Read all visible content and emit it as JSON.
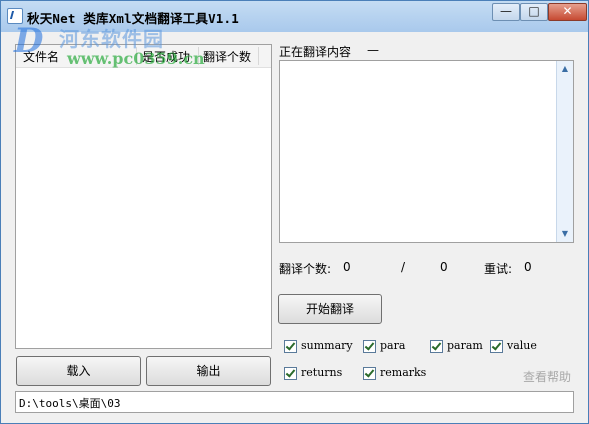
{
  "window": {
    "title": "秋天Net 类库Xml文档翻译工具V1.1",
    "minimize_glyph": "—",
    "maximize_glyph": "□",
    "close_glyph": "✕"
  },
  "watermark": {
    "logo_char": "D",
    "site_name": "河东软件园",
    "url": "www.pc0359.cn"
  },
  "file_list": {
    "columns": [
      "文件名",
      "是否成功",
      "翻译个数"
    ],
    "rows": []
  },
  "translating": {
    "label": "正在翻译内容",
    "value": "—"
  },
  "stats": {
    "count_label": "翻译个数:",
    "count_value": "0",
    "separator": "/",
    "total_value": "0",
    "retry_label": "重试:",
    "retry_value": "0"
  },
  "buttons": {
    "start": "开始翻译",
    "load": "载入",
    "export": "输出"
  },
  "options": [
    {
      "label": "summary",
      "checked": true
    },
    {
      "label": "para",
      "checked": true
    },
    {
      "label": "param",
      "checked": true
    },
    {
      "label": "value",
      "checked": true
    },
    {
      "label": "returns",
      "checked": true
    },
    {
      "label": "remarks",
      "checked": true
    }
  ],
  "help_link": "查看帮助",
  "path": "D:\\tools\\桌面\\03",
  "colors": {
    "titlebar": "#b4d2f0",
    "close_button": "#c64a32",
    "scrollbar": "#eaf2fb",
    "help_link": "#a8a8a8"
  }
}
